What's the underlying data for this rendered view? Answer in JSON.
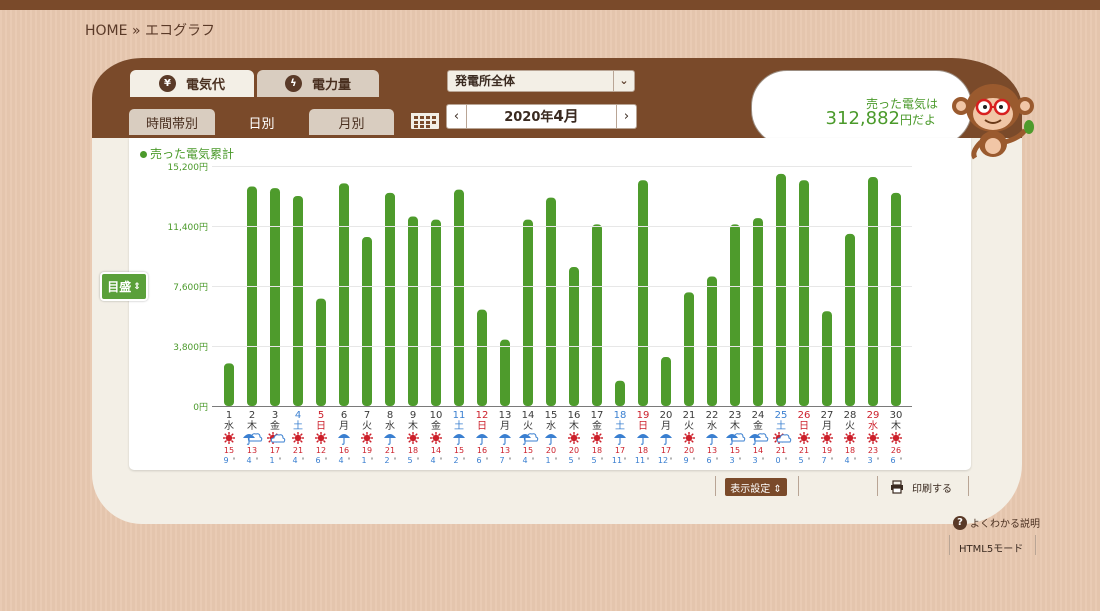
{
  "breadcrumb": {
    "home": "HOME",
    "sep": "»",
    "current": "エコグラフ"
  },
  "tabs": {
    "electricity_cost": {
      "label": "電気代",
      "icon": "yen-icon"
    },
    "power_amount": {
      "label": "電力量",
      "icon": "lightning-icon"
    }
  },
  "plant_select": {
    "value": "発電所全体"
  },
  "subtabs": {
    "hourly": "時間帯別",
    "daily": "日別",
    "monthly": "月別",
    "active": "日別"
  },
  "date_nav": {
    "prev": "‹",
    "next": "›",
    "year_part": "2020年",
    "month_part": "4月"
  },
  "bubble": {
    "line1": "売った電気は",
    "amount": "312,882",
    "suffix": "円だよ"
  },
  "scale_button": {
    "label": "目盛",
    "arrow": "⇕"
  },
  "footer": {
    "display_settings": "表示設定 ⇕",
    "print": "印刷する",
    "help": "よくわかる説明",
    "help_icon": "?",
    "html5": "HTML5モード"
  },
  "colors": {
    "bar": "#4e9b2c",
    "brand_brown": "#7a4a2a",
    "saturday": "#3a7fd0",
    "sunday": "#cc1f2a",
    "sun": "#cc1f2a",
    "rain": "#3a7fd0"
  },
  "chart_data": {
    "type": "bar",
    "title": "売った電気累計",
    "xlabel": "",
    "ylabel": "",
    "ylim": [
      0,
      15200
    ],
    "y_ticks": [
      "0円",
      "3,800円",
      "7,600円",
      "11,400円",
      "15,200円"
    ],
    "y_tick_values": [
      0,
      3800,
      7600,
      11400,
      15200
    ],
    "days": [
      "1",
      "2",
      "3",
      "4",
      "5",
      "6",
      "7",
      "8",
      "9",
      "10",
      "11",
      "12",
      "13",
      "14",
      "15",
      "16",
      "17",
      "18",
      "19",
      "20",
      "21",
      "22",
      "23",
      "24",
      "25",
      "26",
      "27",
      "28",
      "29",
      "30"
    ],
    "weekdays": [
      "水",
      "木",
      "金",
      "土",
      "日",
      "月",
      "火",
      "水",
      "木",
      "金",
      "土",
      "日",
      "月",
      "火",
      "水",
      "木",
      "金",
      "土",
      "日",
      "月",
      "火",
      "水",
      "木",
      "金",
      "土",
      "日",
      "月",
      "火",
      "水",
      "木"
    ],
    "day_types": [
      "w",
      "w",
      "w",
      "sat",
      "sun",
      "w",
      "w",
      "w",
      "w",
      "w",
      "sat",
      "sun",
      "w",
      "w",
      "w",
      "w",
      "w",
      "sat",
      "sun",
      "w",
      "w",
      "w",
      "w",
      "w",
      "sat",
      "sun",
      "w",
      "w",
      "sun",
      "w"
    ],
    "values": [
      2700,
      13900,
      13800,
      13300,
      6800,
      14100,
      10700,
      13500,
      12000,
      11800,
      13700,
      6100,
      4200,
      11800,
      13200,
      8800,
      11500,
      1600,
      14300,
      3100,
      7200,
      8200,
      11500,
      11900,
      14700,
      14300,
      6000,
      10900,
      14500,
      13500
    ],
    "weather": [
      "sun",
      "cloud-rain",
      "cloud-sun",
      "sun",
      "sun",
      "rain",
      "sun",
      "rain",
      "sun",
      "sun",
      "rain",
      "rain",
      "rain",
      "cloud-rain",
      "rain",
      "sun",
      "sun",
      "rain",
      "rain",
      "rain",
      "sun",
      "rain",
      "cloud-rain",
      "cloud-rain",
      "cloud-sun",
      "sun",
      "sun",
      "sun",
      "sun",
      "sun"
    ],
    "temp_high": [
      "15",
      "13",
      "17",
      "21",
      "12",
      "16",
      "19",
      "21",
      "18",
      "14",
      "15",
      "16",
      "13",
      "15",
      "20",
      "20",
      "18",
      "17",
      "18",
      "17",
      "20",
      "13",
      "15",
      "14",
      "21",
      "21",
      "19",
      "18",
      "23",
      "26"
    ],
    "temp_low": [
      "9",
      "4",
      "1",
      "4",
      "6",
      "4",
      "1",
      "2",
      "5",
      "4",
      "2",
      "6",
      "7",
      "4",
      "1",
      "5",
      "5",
      "11",
      "11",
      "12",
      "9",
      "6",
      "3",
      "3",
      "0",
      "5",
      "7",
      "4",
      "3",
      "6"
    ],
    "temp_unit": "°"
  }
}
